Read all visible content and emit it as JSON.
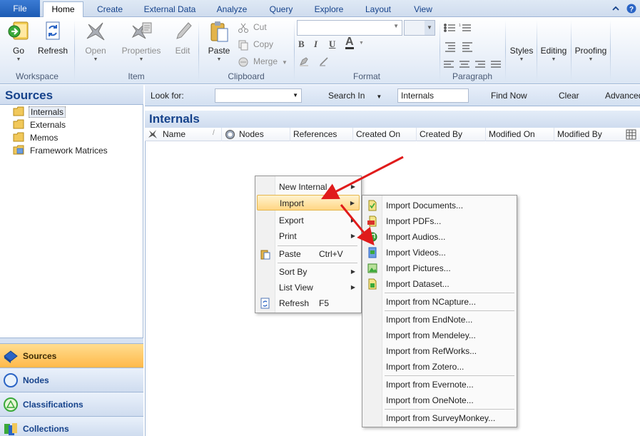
{
  "ribbon_tabs": [
    "File",
    "Home",
    "Create",
    "External Data",
    "Analyze",
    "Query",
    "Explore",
    "Layout",
    "View"
  ],
  "ribbon": {
    "workspace": {
      "go": "Go",
      "refresh": "Refresh",
      "group": "Workspace"
    },
    "item": {
      "open": "Open",
      "properties": "Properties",
      "edit": "Edit",
      "group": "Item"
    },
    "clipboard": {
      "paste": "Paste",
      "cut": "Cut",
      "copy": "Copy",
      "merge": "Merge",
      "group": "Clipboard"
    },
    "format": {
      "bold": "B",
      "italic": "I",
      "underline": "U",
      "font_color": "A",
      "group": "Format"
    },
    "paragraph": {
      "group": "Paragraph"
    },
    "styles": "Styles",
    "editing": "Editing",
    "proofing": "Proofing"
  },
  "sources_panel": {
    "title": "Sources",
    "items": [
      "Internals",
      "Externals",
      "Memos",
      "Framework Matrices"
    ]
  },
  "nav_buttons": [
    "Sources",
    "Nodes",
    "Classifications",
    "Collections"
  ],
  "find_bar": {
    "look_for_label": "Look for:",
    "look_for_value": "",
    "search_in_label": "Search In",
    "search_in_value": "Internals",
    "find_now": "Find Now",
    "clear": "Clear",
    "advanced": "Advanced"
  },
  "list": {
    "title": "Internals",
    "columns": [
      "Name",
      "Nodes",
      "References",
      "Created On",
      "Created By",
      "Modified On",
      "Modified By"
    ]
  },
  "context_menu": {
    "items": [
      {
        "label": "New Internal",
        "submenu": true
      },
      {
        "label": "Import",
        "submenu": true,
        "highlighted": true
      },
      {
        "label": "Export",
        "submenu": true
      },
      {
        "label": "Print",
        "submenu": true
      },
      {
        "label": "Paste",
        "shortcut": "Ctrl+V"
      },
      {
        "label": "Sort By",
        "submenu": true
      },
      {
        "label": "List View",
        "submenu": true
      },
      {
        "label": "Refresh",
        "shortcut": "F5"
      }
    ]
  },
  "import_submenu": {
    "items": [
      "Import Documents...",
      "Import PDFs...",
      "Import Audios...",
      "Import Videos...",
      "Import Pictures...",
      "Import Dataset...",
      "Import from NCapture...",
      "Import from EndNote...",
      "Import from Mendeley...",
      "Import from RefWorks...",
      "Import from Zotero...",
      "Import from Evernote...",
      "Import from OneNote...",
      "Import from SurveyMonkey..."
    ]
  },
  "colors": {
    "ribbon_blue": "#15428b",
    "highlight": "#ffd684",
    "annotation_arrow": "#e01b1b",
    "nav_active": "#ffb94a"
  }
}
